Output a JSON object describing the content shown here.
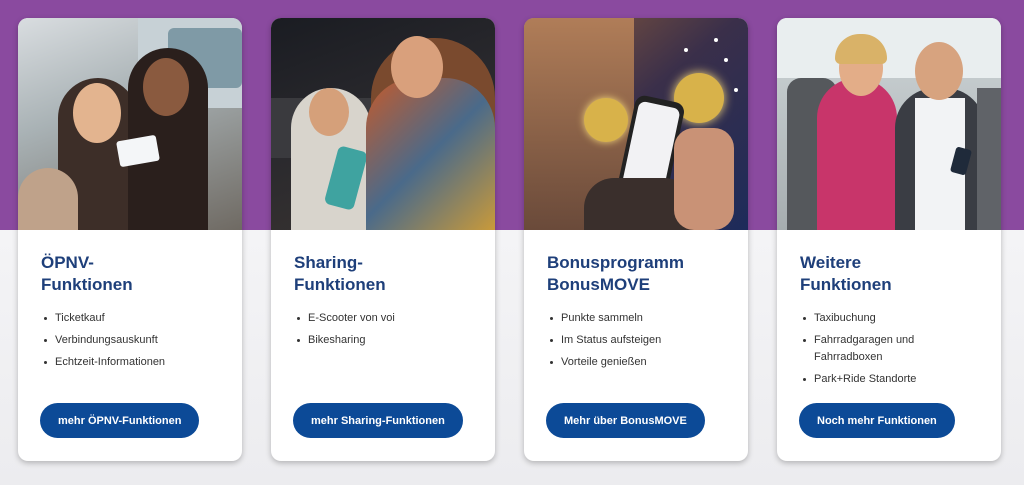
{
  "cards": [
    {
      "title": "ÖPNV-\nFunktionen",
      "bullets": [
        "Ticketkauf",
        "Verbindungsauskunft",
        "Echtzeit-Informationen"
      ],
      "button": "mehr ÖPNV-Funktionen",
      "image": "photo-two-women-holding-tickets"
    },
    {
      "title": "Sharing-\nFunktionen",
      "bullets": [
        "E-Scooter von voi",
        "Bikesharing"
      ],
      "button": "mehr Sharing-Funktionen",
      "image": "photo-couple-with-escooter-at-night"
    },
    {
      "title": "Bonusprogramm\nBonusMOVE",
      "bullets": [
        "Punkte sammeln",
        "Im Status aufsteigen",
        "Vorteile genießen"
      ],
      "button": "Mehr über BonusMOVE",
      "image": "photo-hand-holding-smartphone-with-coins"
    },
    {
      "title": "Weitere\nFunktionen",
      "bullets": [
        "Taxibuchung",
        "Fahrradgaragen und Fahrradboxen",
        "Park+Ride Standorte"
      ],
      "button": "Noch mehr Funktionen",
      "image": "photo-couple-in-car-using-phone"
    }
  ],
  "colors": {
    "band": "#8a4a9f",
    "title": "#1e3f7a",
    "button": "#0c4a97"
  }
}
